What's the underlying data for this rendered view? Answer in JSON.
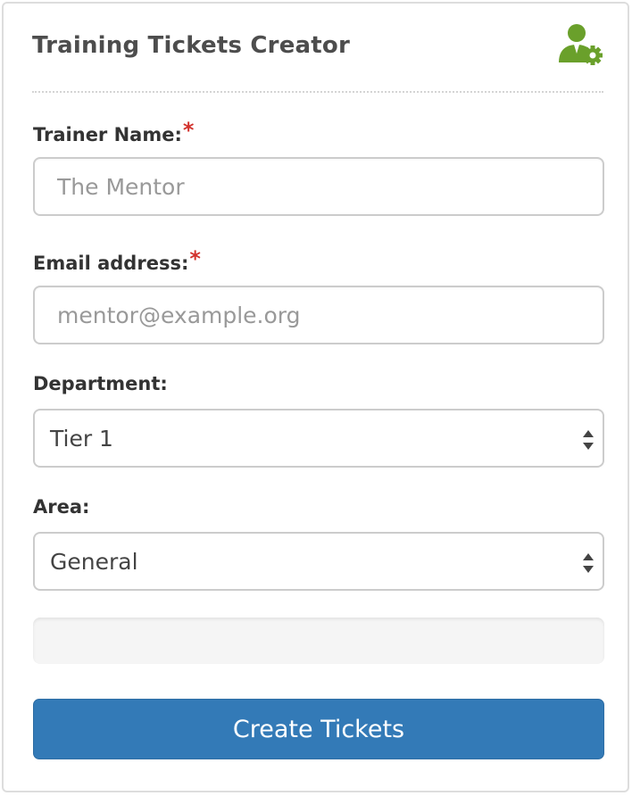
{
  "panel": {
    "title": "Training Tickets Creator",
    "icon": "user-settings-icon"
  },
  "form": {
    "trainer": {
      "label": "Trainer Name:",
      "required_mark": "*",
      "placeholder": "The Mentor",
      "value": ""
    },
    "email": {
      "label": "Email address:",
      "required_mark": "*",
      "placeholder": "mentor@example.org",
      "value": ""
    },
    "department": {
      "label": "Department:",
      "selected": "Tier 1"
    },
    "area": {
      "label": "Area:",
      "selected": "General"
    },
    "progress": {
      "value": 0
    },
    "submit_label": "Create Tickets"
  },
  "colors": {
    "accent": "#337ab7",
    "required": "#d2322d",
    "icon_green": "#6aa02b"
  }
}
